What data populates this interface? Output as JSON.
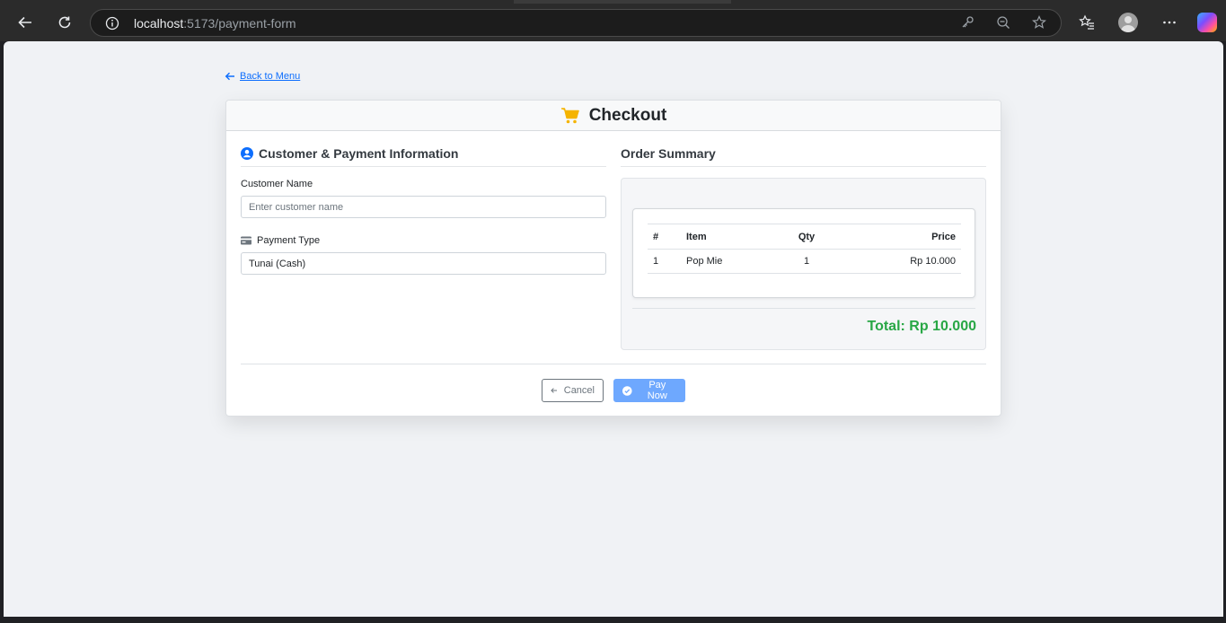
{
  "browser": {
    "url_host": "localhost",
    "url_rest": ":5173/payment-form"
  },
  "page": {
    "back_link": "Back to Menu",
    "title": "Checkout"
  },
  "customer_section": {
    "title": "Customer & Payment Information",
    "name_label": "Customer Name",
    "name_placeholder": "Enter customer name",
    "name_value": "",
    "payment_label": "Payment Type",
    "payment_value": "Tunai (Cash)"
  },
  "order_summary": {
    "title": "Order Summary",
    "columns": [
      "#",
      "Item",
      "Qty",
      "Price"
    ],
    "rows": [
      {
        "num": "1",
        "item": "Pop Mie",
        "qty": "1",
        "price": "Rp 10.000"
      }
    ],
    "total": "Total: Rp 10.000"
  },
  "actions": {
    "cancel_label": "Cancel",
    "pay_label": "Pay Now"
  },
  "colors": {
    "accent": "#0d6efd",
    "total_green": "#28a745",
    "cart_yellow": "#f5b400",
    "pay_button": "#6ea8fe"
  },
  "icons": [
    "back-arrow-icon",
    "refresh-icon",
    "info-icon",
    "key-icon",
    "zoom-out-icon",
    "star-icon",
    "favorites-icon",
    "profile-icon",
    "more-icon",
    "copilot-icon",
    "arrow-left-icon",
    "cart-icon",
    "user-circle-icon",
    "credit-card-icon",
    "check-circle-icon"
  ]
}
